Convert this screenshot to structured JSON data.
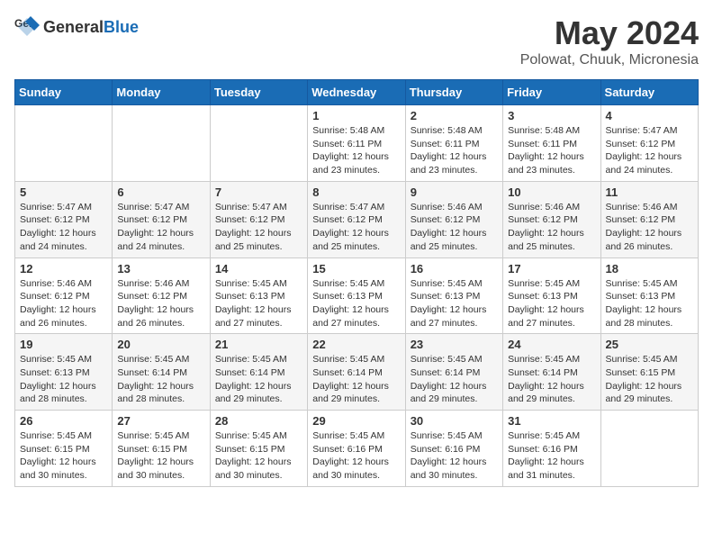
{
  "header": {
    "logo_general": "General",
    "logo_blue": "Blue",
    "month_title": "May 2024",
    "location": "Polowat, Chuuk, Micronesia"
  },
  "weekdays": [
    "Sunday",
    "Monday",
    "Tuesday",
    "Wednesday",
    "Thursday",
    "Friday",
    "Saturday"
  ],
  "weeks": [
    [
      {
        "day": "",
        "info": ""
      },
      {
        "day": "",
        "info": ""
      },
      {
        "day": "",
        "info": ""
      },
      {
        "day": "1",
        "info": "Sunrise: 5:48 AM\nSunset: 6:11 PM\nDaylight: 12 hours\nand 23 minutes."
      },
      {
        "day": "2",
        "info": "Sunrise: 5:48 AM\nSunset: 6:11 PM\nDaylight: 12 hours\nand 23 minutes."
      },
      {
        "day": "3",
        "info": "Sunrise: 5:48 AM\nSunset: 6:11 PM\nDaylight: 12 hours\nand 23 minutes."
      },
      {
        "day": "4",
        "info": "Sunrise: 5:47 AM\nSunset: 6:12 PM\nDaylight: 12 hours\nand 24 minutes."
      }
    ],
    [
      {
        "day": "5",
        "info": "Sunrise: 5:47 AM\nSunset: 6:12 PM\nDaylight: 12 hours\nand 24 minutes."
      },
      {
        "day": "6",
        "info": "Sunrise: 5:47 AM\nSunset: 6:12 PM\nDaylight: 12 hours\nand 24 minutes."
      },
      {
        "day": "7",
        "info": "Sunrise: 5:47 AM\nSunset: 6:12 PM\nDaylight: 12 hours\nand 25 minutes."
      },
      {
        "day": "8",
        "info": "Sunrise: 5:47 AM\nSunset: 6:12 PM\nDaylight: 12 hours\nand 25 minutes."
      },
      {
        "day": "9",
        "info": "Sunrise: 5:46 AM\nSunset: 6:12 PM\nDaylight: 12 hours\nand 25 minutes."
      },
      {
        "day": "10",
        "info": "Sunrise: 5:46 AM\nSunset: 6:12 PM\nDaylight: 12 hours\nand 25 minutes."
      },
      {
        "day": "11",
        "info": "Sunrise: 5:46 AM\nSunset: 6:12 PM\nDaylight: 12 hours\nand 26 minutes."
      }
    ],
    [
      {
        "day": "12",
        "info": "Sunrise: 5:46 AM\nSunset: 6:12 PM\nDaylight: 12 hours\nand 26 minutes."
      },
      {
        "day": "13",
        "info": "Sunrise: 5:46 AM\nSunset: 6:12 PM\nDaylight: 12 hours\nand 26 minutes."
      },
      {
        "day": "14",
        "info": "Sunrise: 5:45 AM\nSunset: 6:13 PM\nDaylight: 12 hours\nand 27 minutes."
      },
      {
        "day": "15",
        "info": "Sunrise: 5:45 AM\nSunset: 6:13 PM\nDaylight: 12 hours\nand 27 minutes."
      },
      {
        "day": "16",
        "info": "Sunrise: 5:45 AM\nSunset: 6:13 PM\nDaylight: 12 hours\nand 27 minutes."
      },
      {
        "day": "17",
        "info": "Sunrise: 5:45 AM\nSunset: 6:13 PM\nDaylight: 12 hours\nand 27 minutes."
      },
      {
        "day": "18",
        "info": "Sunrise: 5:45 AM\nSunset: 6:13 PM\nDaylight: 12 hours\nand 28 minutes."
      }
    ],
    [
      {
        "day": "19",
        "info": "Sunrise: 5:45 AM\nSunset: 6:13 PM\nDaylight: 12 hours\nand 28 minutes."
      },
      {
        "day": "20",
        "info": "Sunrise: 5:45 AM\nSunset: 6:14 PM\nDaylight: 12 hours\nand 28 minutes."
      },
      {
        "day": "21",
        "info": "Sunrise: 5:45 AM\nSunset: 6:14 PM\nDaylight: 12 hours\nand 29 minutes."
      },
      {
        "day": "22",
        "info": "Sunrise: 5:45 AM\nSunset: 6:14 PM\nDaylight: 12 hours\nand 29 minutes."
      },
      {
        "day": "23",
        "info": "Sunrise: 5:45 AM\nSunset: 6:14 PM\nDaylight: 12 hours\nand 29 minutes."
      },
      {
        "day": "24",
        "info": "Sunrise: 5:45 AM\nSunset: 6:14 PM\nDaylight: 12 hours\nand 29 minutes."
      },
      {
        "day": "25",
        "info": "Sunrise: 5:45 AM\nSunset: 6:15 PM\nDaylight: 12 hours\nand 29 minutes."
      }
    ],
    [
      {
        "day": "26",
        "info": "Sunrise: 5:45 AM\nSunset: 6:15 PM\nDaylight: 12 hours\nand 30 minutes."
      },
      {
        "day": "27",
        "info": "Sunrise: 5:45 AM\nSunset: 6:15 PM\nDaylight: 12 hours\nand 30 minutes."
      },
      {
        "day": "28",
        "info": "Sunrise: 5:45 AM\nSunset: 6:15 PM\nDaylight: 12 hours\nand 30 minutes."
      },
      {
        "day": "29",
        "info": "Sunrise: 5:45 AM\nSunset: 6:16 PM\nDaylight: 12 hours\nand 30 minutes."
      },
      {
        "day": "30",
        "info": "Sunrise: 5:45 AM\nSunset: 6:16 PM\nDaylight: 12 hours\nand 30 minutes."
      },
      {
        "day": "31",
        "info": "Sunrise: 5:45 AM\nSunset: 6:16 PM\nDaylight: 12 hours\nand 31 minutes."
      },
      {
        "day": "",
        "info": ""
      }
    ]
  ]
}
